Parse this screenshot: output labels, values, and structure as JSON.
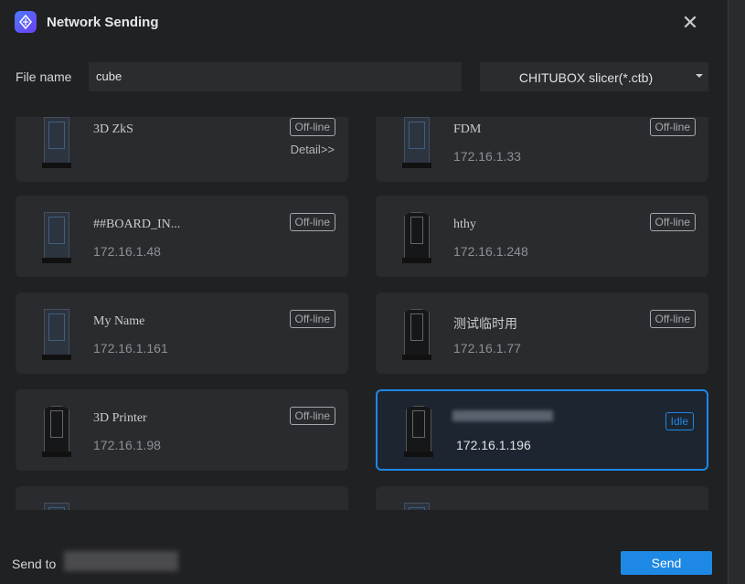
{
  "window": {
    "title": "Network Sending",
    "close_icon": "close-icon"
  },
  "file": {
    "label": "File name",
    "value": "cube"
  },
  "format": {
    "selected": "CHITUBOX slicer(*.ctb)"
  },
  "printers": [
    {
      "name": "3D ZkS",
      "ip": "",
      "status": "Off-line",
      "detail": "Detail>>"
    },
    {
      "name": "FDM",
      "ip": "172.16.1.33",
      "status": "Off-line"
    },
    {
      "name": "##BOARD_IN...",
      "ip": "172.16.1.48",
      "status": "Off-line"
    },
    {
      "name": "hthy",
      "ip": "172.16.1.248",
      "status": "Off-line"
    },
    {
      "name": "My Name",
      "ip": "172.16.1.161",
      "status": "Off-line"
    },
    {
      "name": "测试临时用",
      "ip": "172.16.1.77",
      "status": "Off-line"
    },
    {
      "name": "3D Printer",
      "ip": "172.16.1.98",
      "status": "Off-line"
    },
    {
      "name": "",
      "ip": "172.16.1.196",
      "status": "Idle",
      "selected": true
    }
  ],
  "footer": {
    "send_to_label": "Send to",
    "send_label": "Send"
  },
  "colors": {
    "accent": "#1e88e5",
    "background": "#202123",
    "card": "#2a2b2e"
  }
}
